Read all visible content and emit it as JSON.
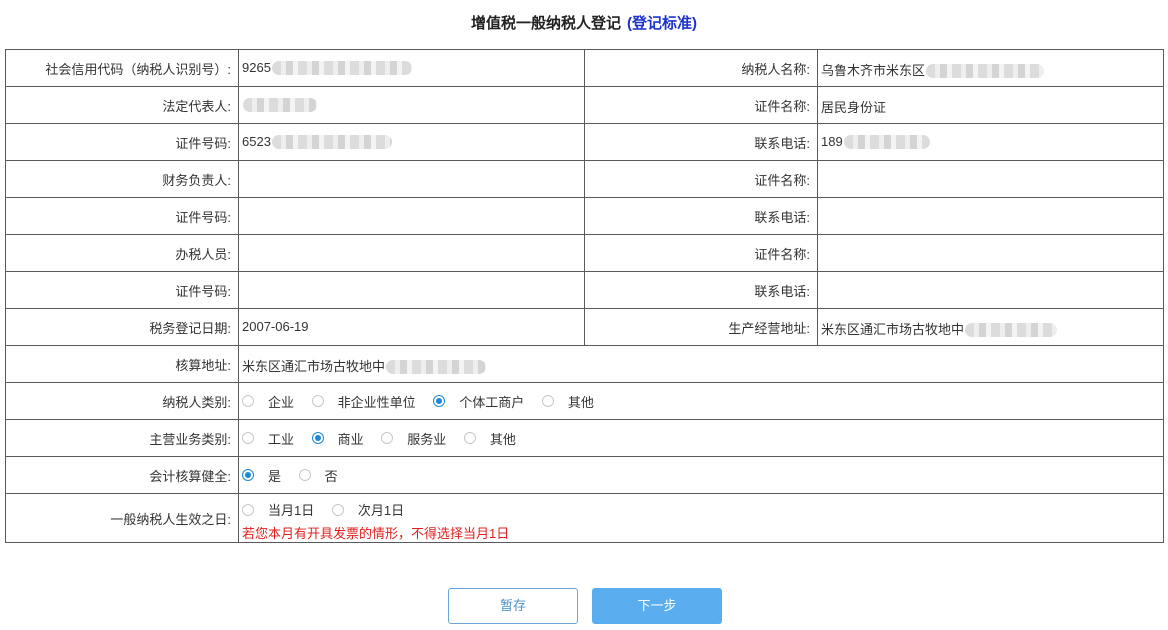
{
  "header": {
    "title": "增值税一般纳税人登记",
    "standard_link": "(登记标准)"
  },
  "form": {
    "credit_code": {
      "label": "社会信用代码（纳税人识别号）:",
      "value": "9265"
    },
    "taxpayer_name": {
      "label": "纳税人名称:",
      "value": "乌鲁木齐市米东区"
    },
    "legal_rep": {
      "label": "法定代表人:",
      "value": ""
    },
    "legal_rep_id_type": {
      "label": "证件名称:",
      "value": "居民身份证"
    },
    "legal_rep_id_no": {
      "label": "证件号码:",
      "value": "6523"
    },
    "legal_rep_phone": {
      "label": "联系电话:",
      "value": "189"
    },
    "finance_head": {
      "label": "财务负责人:",
      "value": ""
    },
    "finance_id_type": {
      "label": "证件名称:",
      "value": ""
    },
    "finance_id_no": {
      "label": "证件号码:",
      "value": ""
    },
    "finance_phone": {
      "label": "联系电话:",
      "value": ""
    },
    "tax_agent": {
      "label": "办税人员:",
      "value": ""
    },
    "agent_id_type": {
      "label": "证件名称:",
      "value": ""
    },
    "agent_id_no": {
      "label": "证件号码:",
      "value": ""
    },
    "agent_phone": {
      "label": "联系电话:",
      "value": ""
    },
    "reg_date": {
      "label": "税务登记日期:",
      "value": "2007-06-19"
    },
    "biz_address": {
      "label": "生产经营地址:",
      "value": "米东区通汇市场古牧地中"
    },
    "accounting_address": {
      "label": "核算地址:",
      "value": "米东区通汇市场古牧地中"
    },
    "taxpayer_type": {
      "label": "纳税人类别:",
      "options": [
        "企业",
        "非企业性单位",
        "个体工商户",
        "其他"
      ],
      "selected": 2
    },
    "business_type": {
      "label": "主营业务类别:",
      "options": [
        "工业",
        "商业",
        "服务业",
        "其他"
      ],
      "selected": 1
    },
    "accounting_sound": {
      "label": "会计核算健全:",
      "options": [
        "是",
        "否"
      ],
      "selected": 0
    },
    "effective_date": {
      "label": "一般纳税人生效之日:",
      "options": [
        "当月1日",
        "次月1日"
      ],
      "selected": -1,
      "warning": "若您本月有开具发票的情形，不得选择当月1日"
    }
  },
  "buttons": {
    "save_label": "暂存",
    "next_label": "下一步"
  },
  "colors": {
    "accent": "#1e88d8",
    "link": "#1a33cc",
    "warning": "#e02020",
    "primary_button": "#5aaef0"
  }
}
